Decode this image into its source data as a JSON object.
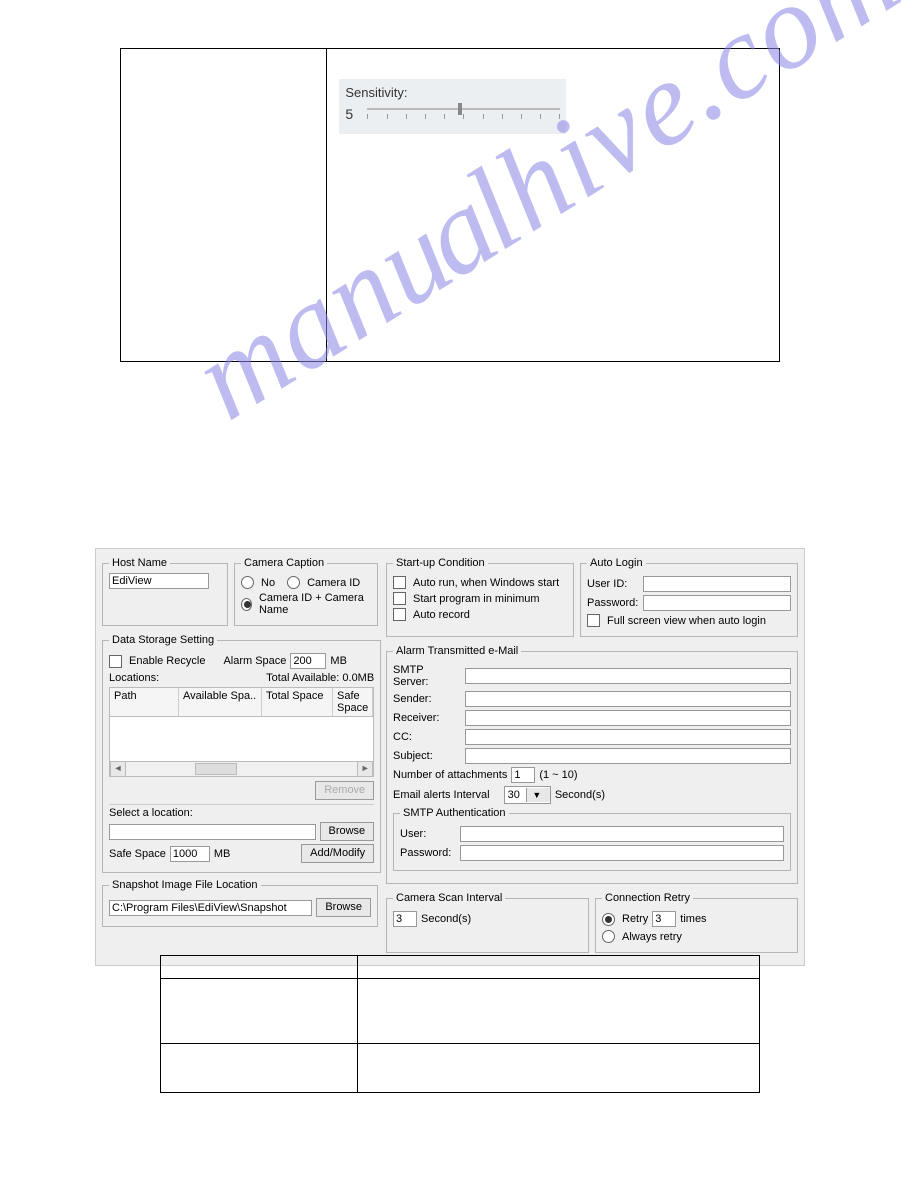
{
  "sensitivity": {
    "label": "Sensitivity:",
    "value": "5"
  },
  "watermark": "hive.com",
  "dialog": {
    "hostName": {
      "legend": "Host Name",
      "value": "EdiView"
    },
    "cameraCaption": {
      "legend": "Camera Caption",
      "optNo": "No",
      "optCameraId": "Camera ID",
      "optCameraIdName": "Camera ID + Camera Name"
    },
    "startup": {
      "legend": "Start-up Condition",
      "autoRun": "Auto run, when Windows start",
      "minProg": "Start program in minimum",
      "autoRecord": "Auto record"
    },
    "autoLogin": {
      "legend": "Auto Login",
      "userId": "User ID:",
      "password": "Password:",
      "fullScreen": "Full screen view when auto login"
    },
    "storage": {
      "legend": "Data Storage Setting",
      "enableRecycle": "Enable Recycle",
      "alarmSpace": "Alarm Space",
      "alarmSpaceValue": "200",
      "mb": "MB",
      "locations": "Locations:",
      "totalAvail": "Total Available: 0.0MB",
      "colPath": "Path",
      "colAvail": "Available Spa..",
      "colTotal": "Total Space",
      "colSafe": "Safe Space",
      "remove": "Remove",
      "selectLocation": "Select a location:",
      "browse": "Browse",
      "safeSpace": "Safe Space",
      "safeSpaceValue": "1000",
      "addModify": "Add/Modify"
    },
    "snapshot": {
      "legend": "Snapshot Image File Location",
      "value": "C:\\Program Files\\EdiView\\Snapshot",
      "browse": "Browse"
    },
    "alarmMail": {
      "legend": "Alarm Transmitted e-Mail",
      "smtp": "SMTP Server:",
      "sender": "Sender:",
      "receiver": "Receiver:",
      "cc": "CC:",
      "subject": "Subject:",
      "numAttach": "Number of attachments",
      "numAttachValue": "1",
      "numAttachRange": "(1 ~ 10)",
      "emailInterval": "Email alerts Interval",
      "emailIntervalValue": "30",
      "seconds": "Second(s)",
      "smtpAuth": "SMTP Authentication",
      "user": "User:",
      "password": "Password:"
    },
    "scan": {
      "legend": "Camera Scan Interval",
      "value": "3",
      "seconds": "Second(s)"
    },
    "retry": {
      "legend": "Connection Retry",
      "retry": "Retry",
      "retryValue": "3",
      "times": "times",
      "always": "Always retry"
    }
  }
}
